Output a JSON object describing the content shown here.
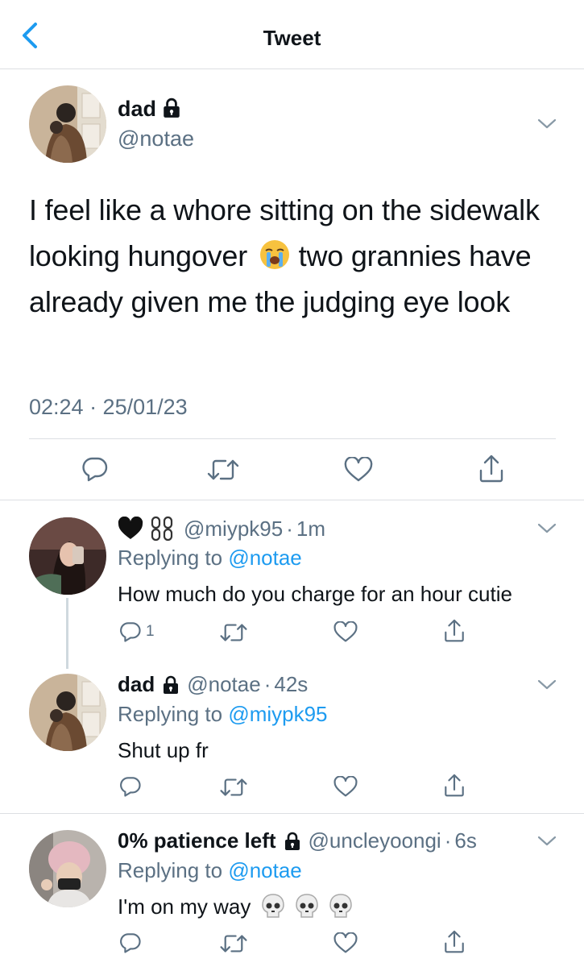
{
  "header": {
    "title": "Tweet",
    "back_icon": "chevron-left-icon"
  },
  "tweet": {
    "display_name": "dad",
    "handle": "@notae",
    "text": "I feel like a whore sitting on the sidewalk looking hungover 😭 two grannies have already given me the judging eye look",
    "text_before_emoji": "I feel like a whore sitting on the sidewalk looking hungover",
    "emoji": "😭",
    "text_after_emoji": "two grannies have already given me the judging eye look",
    "timestamp": "02:24 · 25/01/23",
    "locked": true
  },
  "replies": [
    {
      "display_name": "🖤 ⛓",
      "handle": "@miypk95",
      "time": "1m",
      "replying_label": "Replying to",
      "replying_to": "@notae",
      "text": "How much do you charge for an hour cutie",
      "reply_count": "1",
      "locked": false
    },
    {
      "display_name": "dad",
      "handle": "@notae",
      "time": "42s",
      "replying_label": "Replying to",
      "replying_to": "@miypk95",
      "text": "Shut up fr",
      "reply_count": "",
      "locked": true
    },
    {
      "display_name": "0% patience left",
      "handle": "@uncleyoongi",
      "time": "6s",
      "replying_label": "Replying to",
      "replying_to": "@notae",
      "text": "I'm on my way",
      "emoji": "💀 💀 💀",
      "reply_count": "",
      "locked": true
    }
  ],
  "colors": {
    "accent": "#1d9bf0",
    "muted": "#5b7083",
    "text": "#0f1419",
    "divider": "#dcdfe3"
  }
}
